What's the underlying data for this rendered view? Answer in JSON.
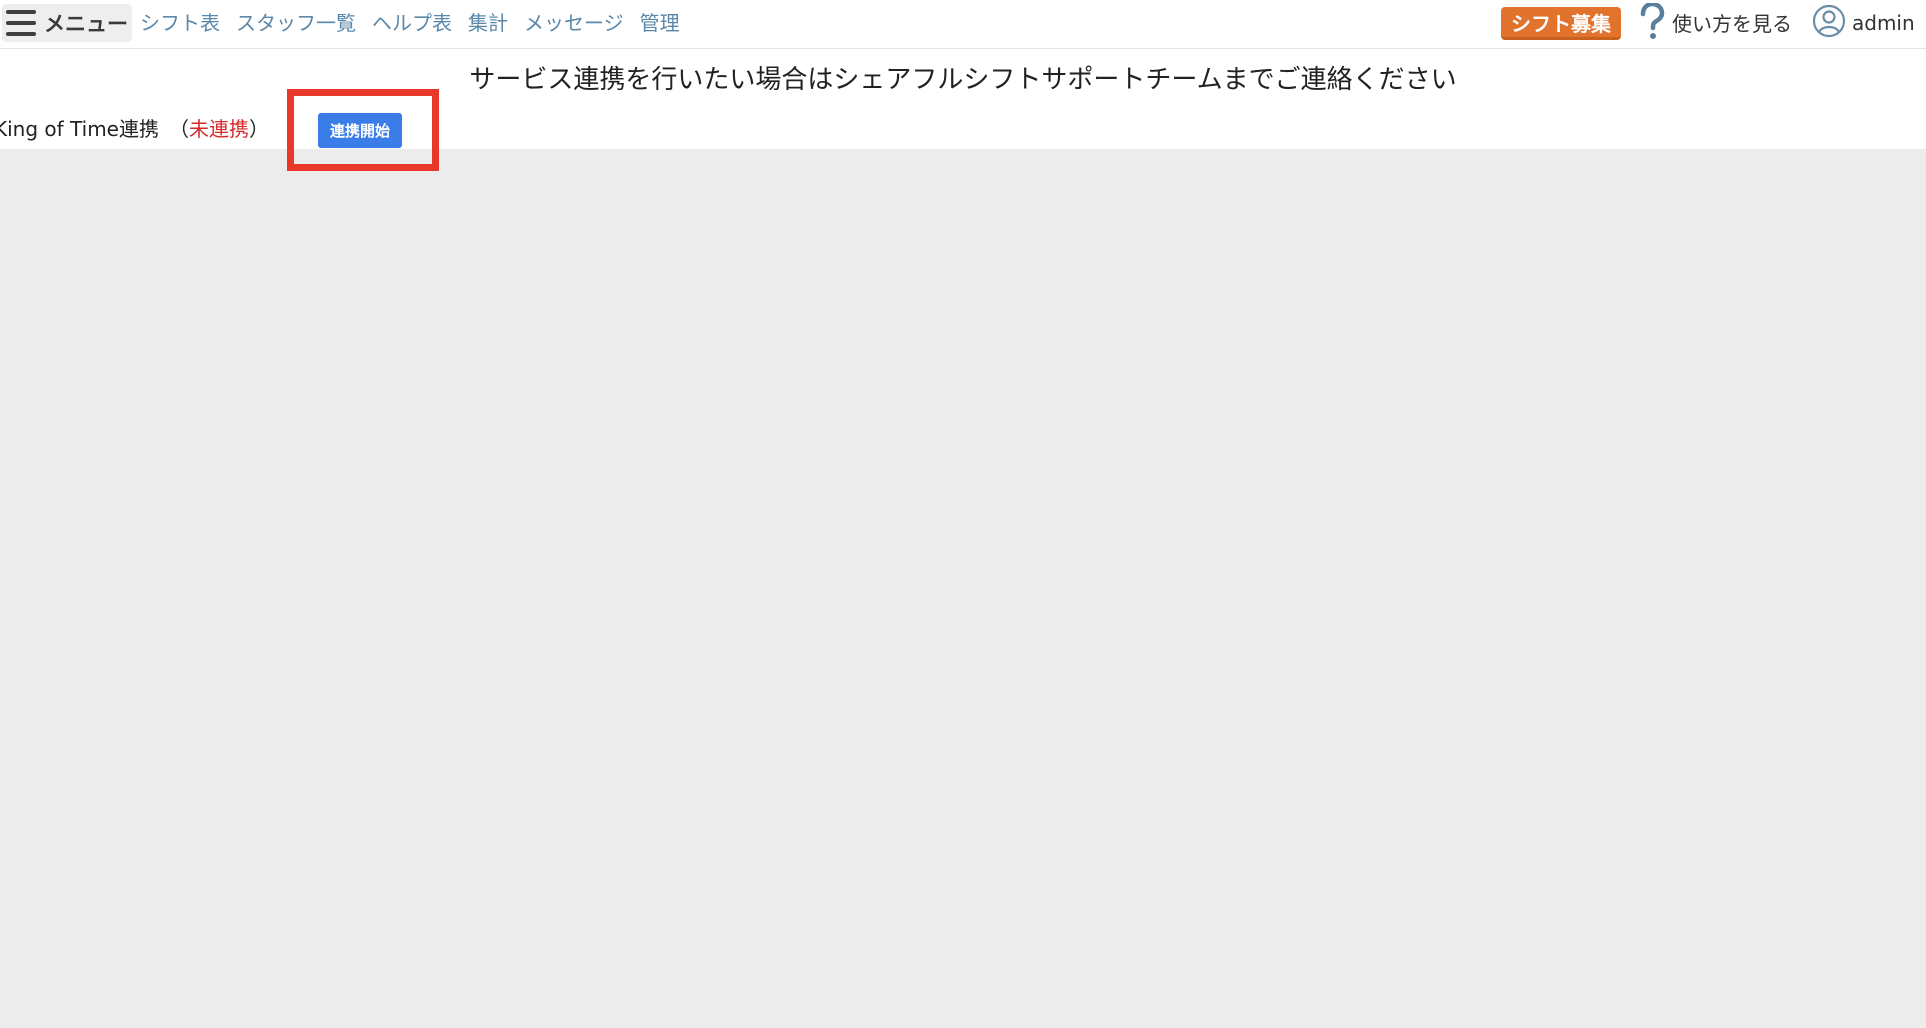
{
  "header": {
    "menu_label": "メニュー",
    "nav": [
      {
        "label": "シフト表"
      },
      {
        "label": "スタッフ一覧"
      },
      {
        "label": "ヘルプ表"
      },
      {
        "label": "集計"
      },
      {
        "label": "メッセージ"
      },
      {
        "label": "管理"
      }
    ],
    "recruit_label": "シフト募集",
    "help_label": "使い方を見る",
    "user_label": "admin"
  },
  "main": {
    "notice": "サービス連携を行いたい場合はシェアフルシフトサポートチームまでご連絡ください",
    "service": {
      "name": "King of Time連携",
      "open_paren": "（",
      "status": "未連携",
      "close_paren": "）",
      "button_label": "連携開始"
    }
  },
  "colors": {
    "nav_link": "#5a88ab",
    "recruit_button": "#e1732c",
    "status_unlinked": "#d62b2b",
    "connect_button": "#3b7de8",
    "highlight_box": "#e8382a",
    "background": "#ececec"
  },
  "icons": {
    "menu": "hamburger-icon",
    "help": "question-mark-icon",
    "user": "user-circle-icon"
  }
}
